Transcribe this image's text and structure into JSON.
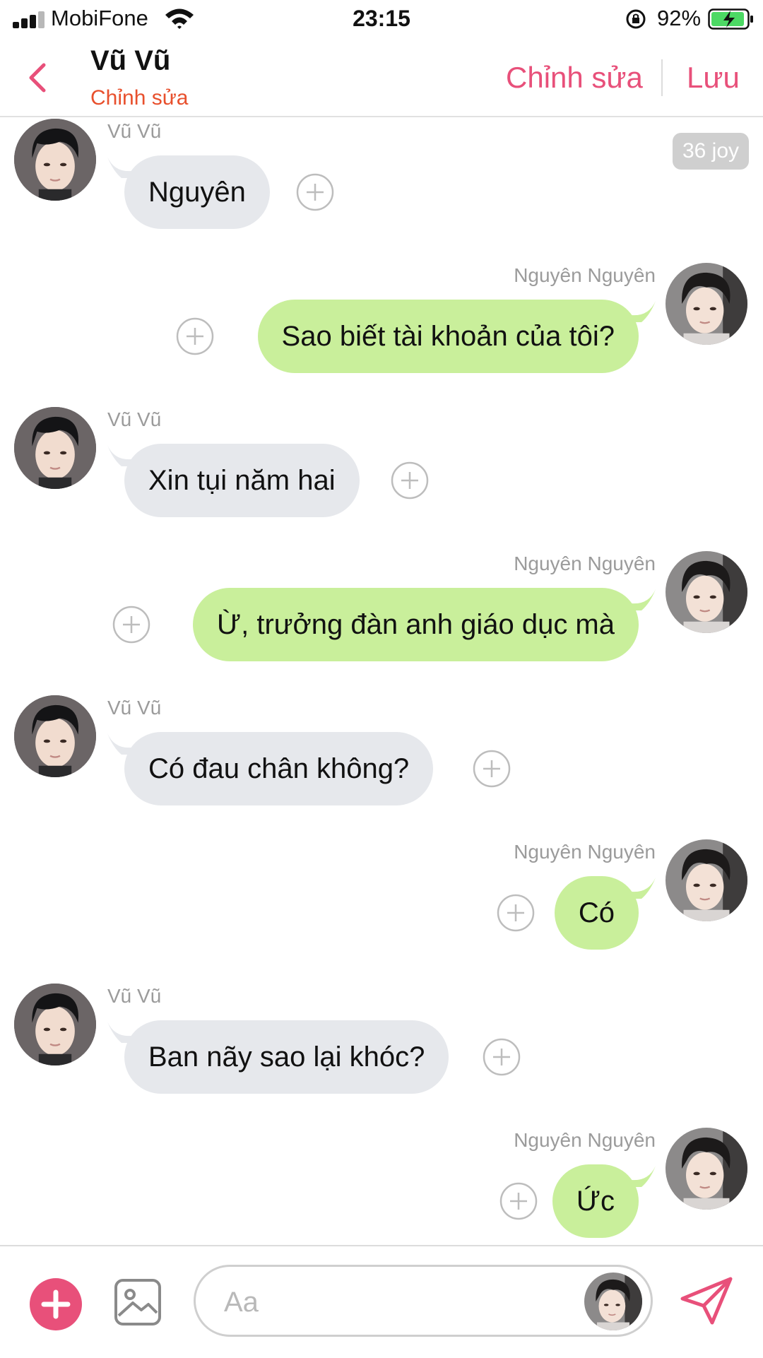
{
  "status_bar": {
    "carrier": "MobiFone",
    "time": "23:15",
    "battery_percent": "92%"
  },
  "header": {
    "title": "Vũ Vũ",
    "subtitle": "Chỉnh sửa",
    "edit_label": "Chỉnh sửa",
    "save_label": "Lưu"
  },
  "timestamp_badge": "36 joy",
  "messages": [
    {
      "sender": "Vũ Vũ",
      "text": "Nguyên"
    },
    {
      "sender": "Nguyên Nguyên",
      "text": "Sao biết tài khoản của tôi?"
    },
    {
      "sender": "Vũ Vũ",
      "text": "Xin tụi năm hai"
    },
    {
      "sender": "Nguyên Nguyên",
      "text": "Ừ, trưởng đàn anh giáo dục mà"
    },
    {
      "sender": "Vũ Vũ",
      "text": "Có đau chân không?"
    },
    {
      "sender": "Nguyên Nguyên",
      "text": "Có"
    },
    {
      "sender": "Vũ Vũ",
      "text": "Ban nãy sao lại khóc?"
    },
    {
      "sender": "Nguyên Nguyên",
      "text": "Ức"
    }
  ],
  "composer": {
    "placeholder": "Aa"
  },
  "icons": [
    "back-icon",
    "add-reaction-icon",
    "add-icon",
    "image-icon",
    "send-icon",
    "wifi-icon",
    "battery-icon",
    "lock-rotation-icon",
    "signal-icon"
  ],
  "colors": {
    "accent": "#e8507a",
    "subtitle": "#e8502d",
    "incoming_bubble": "#e6e8ec",
    "outgoing_bubble": "#c9ef9b"
  }
}
